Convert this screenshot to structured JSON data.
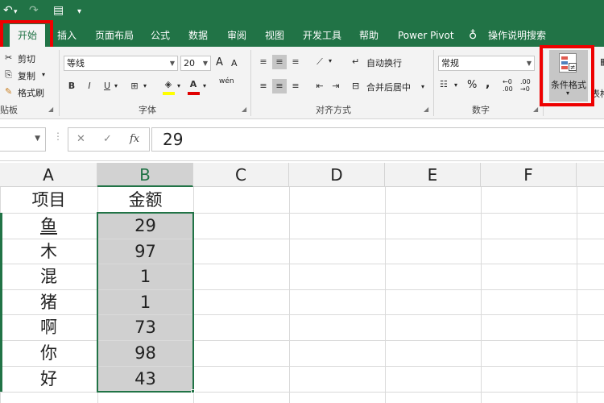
{
  "qat": {
    "undo": "↶",
    "redo": "↷",
    "save": "▤",
    "more": "▾"
  },
  "tabs": [
    {
      "label": "开始"
    },
    {
      "label": "插入"
    },
    {
      "label": "页面布局"
    },
    {
      "label": "公式"
    },
    {
      "label": "数据"
    },
    {
      "label": "审阅"
    },
    {
      "label": "视图"
    },
    {
      "label": "开发工具"
    },
    {
      "label": "帮助"
    },
    {
      "label": "Power Pivot"
    }
  ],
  "tell_me": "操作说明搜索",
  "clipboard": {
    "cut": "剪切",
    "copy": "复制",
    "format_painter": "格式刷",
    "group": "贴板"
  },
  "font": {
    "name": "等线",
    "size": "20",
    "grow": "A",
    "shrink": "A",
    "bold": "B",
    "italic": "I",
    "underline": "U",
    "group": "字体",
    "phonetic": "wén"
  },
  "alignment": {
    "wrap": "自动换行",
    "merge": "合并后居中",
    "group": "对齐方式"
  },
  "number": {
    "format": "常规",
    "percent": "%",
    "comma": ",",
    "group": "数字"
  },
  "styles": {
    "conditional_format": "条件格式",
    "table_format": "表格"
  },
  "formula_bar": {
    "cancel": "✕",
    "enter": "✓",
    "fx": "fx",
    "value": "29"
  },
  "columns": [
    "A",
    "B",
    "C",
    "D",
    "E",
    "F"
  ],
  "rows": [
    {
      "a": "项目",
      "b": "金额"
    },
    {
      "a": "鱼",
      "b": "29"
    },
    {
      "a": "木",
      "b": "97"
    },
    {
      "a": "混",
      "b": "1"
    },
    {
      "a": "猪",
      "b": "1"
    },
    {
      "a": "啊",
      "b": "73"
    },
    {
      "a": "你",
      "b": "98"
    },
    {
      "a": "好",
      "b": "43"
    }
  ],
  "colors": {
    "accent": "#217346",
    "highlight": "#e00000",
    "selection": "#d0d0d0"
  }
}
